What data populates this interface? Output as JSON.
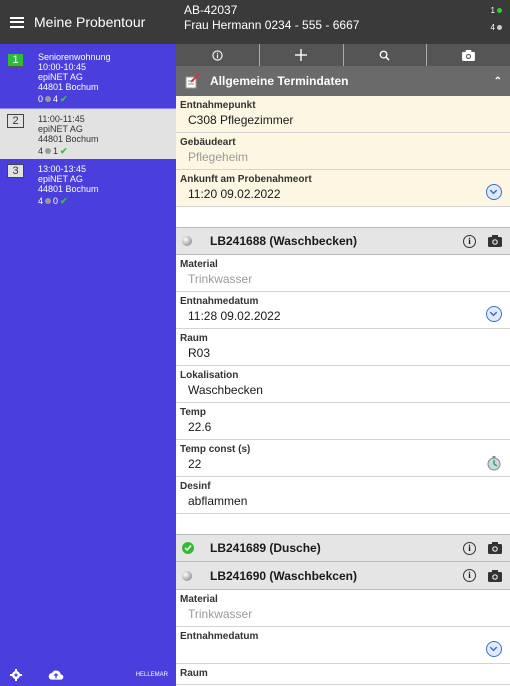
{
  "sidebar": {
    "title": "Meine Probentour",
    "tours": [
      {
        "num": "1",
        "name": "Seniorenwohnung",
        "time": "10:00-10:45",
        "company": "epiNET AG",
        "city": "44801 Bochum",
        "open": "0",
        "done": "4"
      },
      {
        "num": "2",
        "name": "",
        "time": "11:00-11:45",
        "company": "epiNET AG",
        "city": "44801 Bochum",
        "open": "4",
        "done": "1"
      },
      {
        "num": "3",
        "name": "",
        "time": "13:00-13:45",
        "company": "epiNET AG",
        "city": "44801 Bochum",
        "open": "4",
        "done": "0"
      }
    ],
    "footer_user": "HELLEMAR"
  },
  "header": {
    "order_id": "AB-42037",
    "contact": "Frau Hermann 0234 - 555 - 6667",
    "count_done": "1",
    "count_open": "4"
  },
  "toolbar": {
    "icons": [
      "info-icon",
      "plus-icon",
      "search-icon",
      "camera-icon"
    ],
    "plus_label": "+",
    "info_label": "ⓘ"
  },
  "section": {
    "title": "Allgemeine Termindaten",
    "fields": {
      "entnahmepunkt_label": "Entnahmepunkt",
      "entnahmepunkt_value": "C308 Pflegezimmer",
      "gebaeudeart_label": "Gebäudeart",
      "gebaeudeart_value": "Pflegeheim",
      "ankunft_label": "Ankunft am Probenahmeort",
      "ankunft_value": "11:20 09.02.2022"
    }
  },
  "samples": [
    {
      "title": "LB241688 (Waschbecken)",
      "status": "grey",
      "fields": {
        "material_label": "Material",
        "material_value": "Trinkwasser",
        "datum_label": "Entnahmedatum",
        "datum_value": "11:28 09.02.2022",
        "raum_label": "Raum",
        "raum_value": "R03",
        "lokal_label": "Lokalisation",
        "lokal_value": "Waschbecken",
        "temp_label": "Temp",
        "temp_value": "22.6",
        "tempc_label": "Temp const (s)",
        "tempc_value": "22",
        "desinf_label": "Desinf",
        "desinf_value": "abflammen"
      }
    },
    {
      "title": "LB241689 (Dusche)",
      "status": "done"
    },
    {
      "title": "LB241690 (Waschbekcen)",
      "status": "grey",
      "fields": {
        "material_label": "Material",
        "material_value": "Trinkwasser",
        "datum_label": "Entnahmedatum",
        "datum_value": "",
        "raum_label": "Raum"
      }
    }
  ],
  "colors": {
    "sidebar": "#4a3fdd",
    "header": "#3a3a3a",
    "accent_green": "#2dbd3a",
    "field_yellow": "#fcf6e2"
  }
}
